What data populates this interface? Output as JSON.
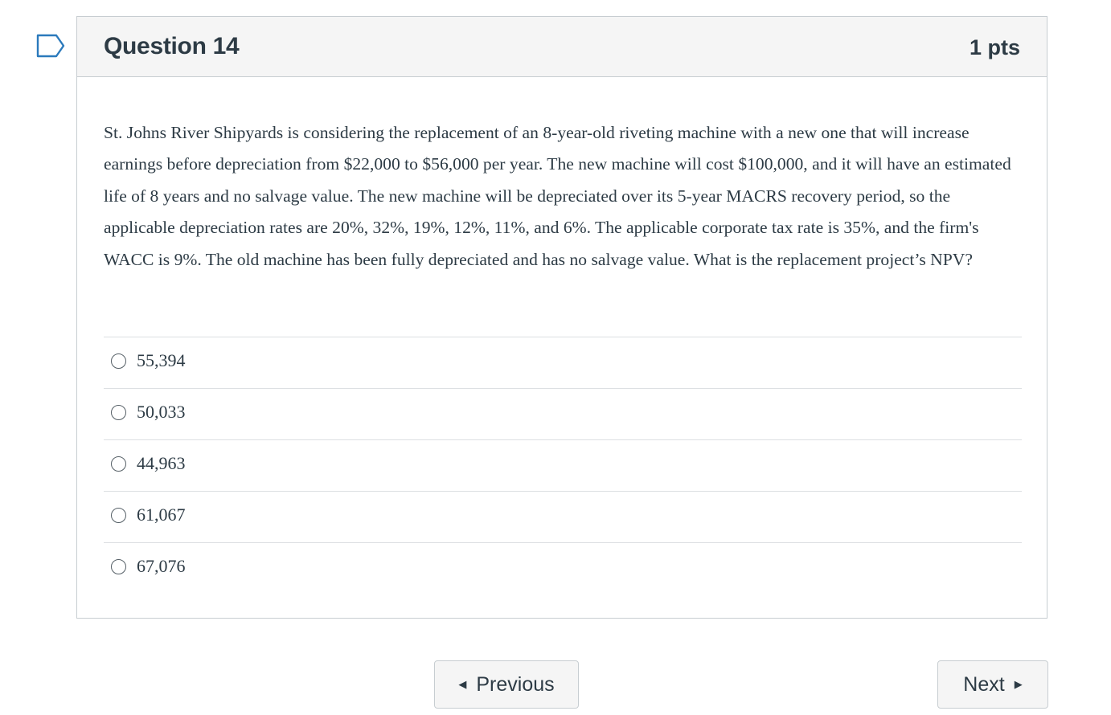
{
  "question": {
    "title": "Question 14",
    "points": "1 pts",
    "text": "St. Johns River Shipyards is considering the replacement of an 8-year-old riveting machine with a new one that will increase earnings before depreciation from $22,000 to $56,000 per year. The new machine will cost $100,000, and it will have an estimated life of 8 years and no salvage value. The new machine will be depreciated over its 5-year MACRS recovery period, so the applicable depreciation rates are 20%, 32%, 19%, 12%, 11%, and 6%. The applicable corporate tax rate is 35%, and the firm's WACC is 9%. The old machine has been fully depreciated and has no salvage value. What is the replacement project’s NPV?",
    "answers": [
      {
        "label": "55,394"
      },
      {
        "label": "50,033"
      },
      {
        "label": "44,963"
      },
      {
        "label": "61,067"
      },
      {
        "label": "67,076"
      }
    ]
  },
  "navigation": {
    "previous_label": "Previous",
    "next_label": "Next",
    "previous_icon": "caret-left-icon",
    "next_icon": "caret-right-icon"
  },
  "flag": {
    "icon": "bookmark-flag-icon"
  },
  "colors": {
    "text": "#2d3b45",
    "header_bg": "#f5f5f5",
    "border": "#c7cdd1",
    "divider": "#dcdfe2"
  }
}
